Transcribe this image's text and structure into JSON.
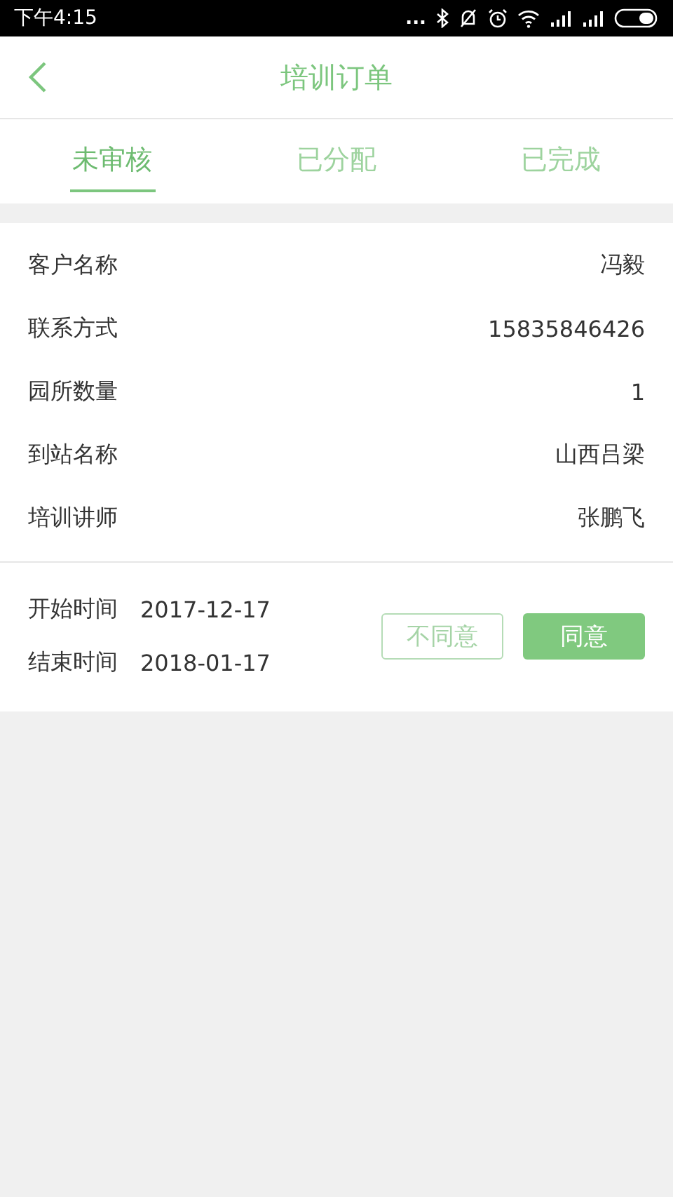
{
  "status_bar": {
    "time": "下午4:15",
    "dots": "..."
  },
  "header": {
    "title": "培训订单"
  },
  "tabs": [
    {
      "label": "未审核",
      "selected": true
    },
    {
      "label": "已分配",
      "selected": false
    },
    {
      "label": "已完成",
      "selected": false
    }
  ],
  "order": {
    "fields": [
      {
        "label": "客户名称",
        "value": "冯毅"
      },
      {
        "label": "联系方式",
        "value": "15835846426"
      },
      {
        "label": "园所数量",
        "value": "1"
      },
      {
        "label": "到站名称",
        "value": "山西吕梁"
      },
      {
        "label": "培训讲师",
        "value": "张鹏飞"
      }
    ],
    "dates": [
      {
        "label": "开始时间",
        "value": "2017-12-17"
      },
      {
        "label": "结束时间",
        "value": "2018-01-17"
      }
    ],
    "buttons": [
      {
        "label": "不同意",
        "kind": "outline"
      },
      {
        "label": "同意",
        "kind": "filled"
      }
    ]
  }
}
